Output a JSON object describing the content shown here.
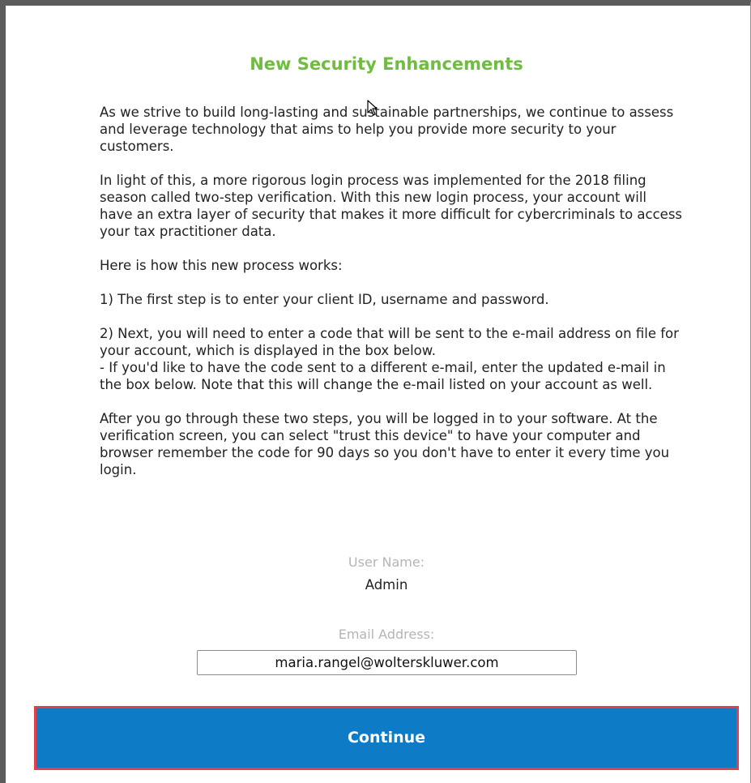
{
  "dialog": {
    "title": "New Security Enhancements",
    "paragraphs": {
      "intro": "As we strive to build long-lasting and sustainable partnerships, we continue to assess and leverage technology that aims to help you provide more security to your customers.",
      "context": "In light of this, a more rigorous login process was implemented for the 2018 filing season called two-step verification. With this new login process, your account will have an extra layer of security that makes it more difficult for cybercriminals to access your tax practitioner data.",
      "how_it_works": "Here is how this new process works:",
      "step1": "1) The first step is to enter your client ID, username and password.",
      "step2": "2) Next, you will need to enter a code that will be sent to the e-mail address on file for your account, which is displayed in the box below.",
      "step2_note": "- If you'd like to have the code sent to a different e-mail, enter the updated e-mail in the box below. Note that this will change the e-mail listed on your account as well.",
      "closing": "After you go through these two steps, you will be logged in to your software. At the verification screen, you can select \"trust this device\" to have your computer and browser remember the code for 90 days so you don't have to enter it every time you login."
    },
    "user_name_label": "User Name:",
    "user_name_value": "Admin",
    "email_label": "Email Address:",
    "email_value": "maria.rangel@wolterskluwer.com",
    "continue_label": "Continue"
  },
  "colors": {
    "title": "#6fbd3e",
    "button_bg": "#0e7bc7",
    "button_outline": "#e0404a",
    "label": "#b5b5b5"
  },
  "icons": {
    "cursor": "mouse-pointer-icon"
  }
}
